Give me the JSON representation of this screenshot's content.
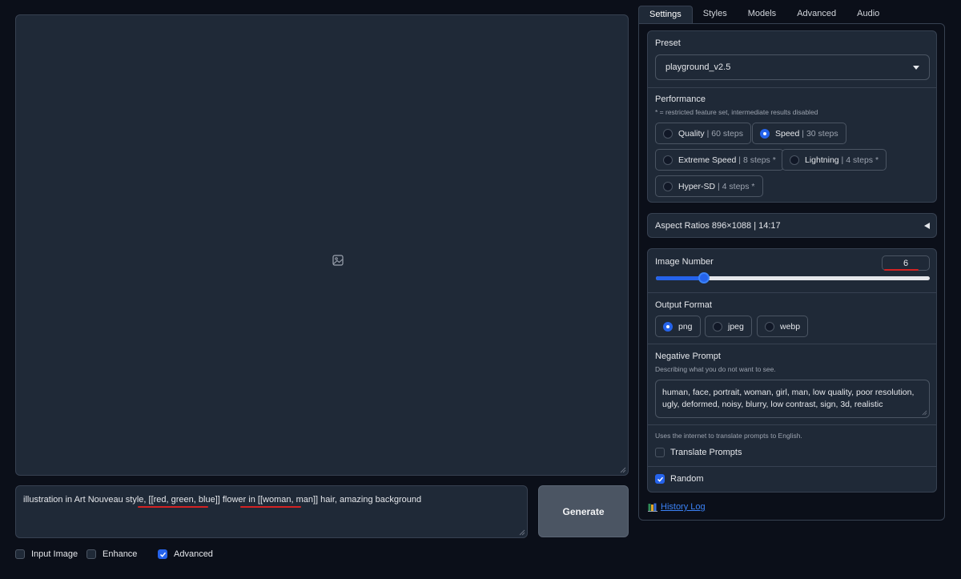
{
  "main": {
    "prompt": {
      "segments": [
        "illustration in Art Nouveau style, ",
        "[[red, green, blue]]",
        " flower in ",
        "[[woman, man]]",
        " hair, amazing background"
      ]
    },
    "generate_label": "Generate",
    "options": {
      "input_image": "Input Image",
      "enhance": "Enhance",
      "advanced": "Advanced"
    }
  },
  "tabs": [
    "Settings",
    "Styles",
    "Models",
    "Advanced",
    "Audio"
  ],
  "settings": {
    "preset": {
      "label": "Preset",
      "value": "playground_v2.5"
    },
    "performance": {
      "label": "Performance",
      "note": "* = restricted feature set, intermediate results disabled",
      "options": [
        {
          "name": "Quality",
          "detail": "| 60 steps"
        },
        {
          "name": "Speed",
          "detail": "| 30 steps"
        },
        {
          "name": "Extreme Speed",
          "detail": "| 8 steps *"
        },
        {
          "name": "Lightning",
          "detail": "| 4 steps *"
        },
        {
          "name": "Hyper-SD",
          "detail": "| 4 steps *"
        }
      ],
      "selected": "Speed"
    },
    "aspect_ratios": {
      "label": "Aspect Ratios 896×1088 | 14:17"
    },
    "image_number": {
      "label": "Image Number",
      "value": "6",
      "slider_fraction": 0.176
    },
    "output_format": {
      "label": "Output Format",
      "options": [
        "png",
        "jpeg",
        "webp"
      ],
      "selected": "png"
    },
    "negative_prompt": {
      "label": "Negative Prompt",
      "note": "Describing what you do not want to see.",
      "value": "human, face, portrait, woman, girl, man, low quality, poor resolution, ugly, deformed, noisy, blurry, low contrast, sign, 3d, realistic"
    },
    "translate": {
      "note": "Uses the internet to translate prompts to English.",
      "label": "Translate Prompts"
    },
    "random": {
      "label": "Random"
    },
    "history_log": "History Log"
  },
  "colors": {
    "background": "#0b0f19",
    "panel": "#1f2937",
    "border": "#374151",
    "accent": "#2563eb",
    "annotation": "#d32323"
  }
}
